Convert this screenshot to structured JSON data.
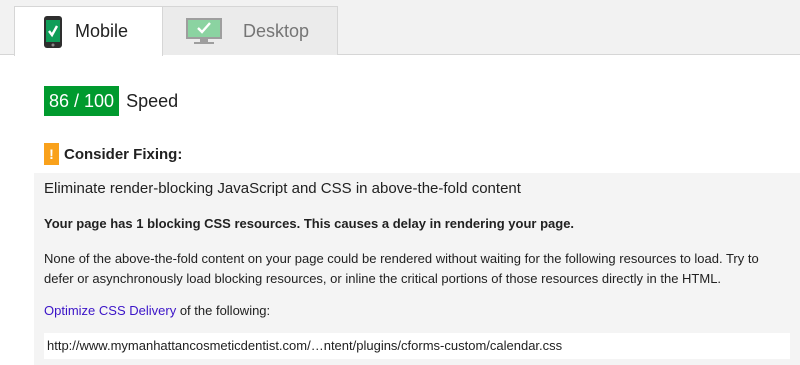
{
  "tabs": [
    {
      "label": "Mobile",
      "icon": "mobile-phone-icon",
      "active": true
    },
    {
      "label": "Desktop",
      "icon": "desktop-monitor-icon",
      "active": false
    }
  ],
  "score": {
    "value": "86 / 100",
    "label": "Speed",
    "color": "#009a2e"
  },
  "consider": {
    "icon": "warning-icon",
    "icon_glyph": "!",
    "label": "Consider Fixing:",
    "color": "#f9a11b"
  },
  "rule": {
    "title": "Eliminate render-blocking JavaScript and CSS in above-the-fold content",
    "summary": "Your page has 1 blocking CSS resources. This causes a delay in rendering your page.",
    "description": "None of the above-the-fold content on your page could be rendered without waiting for the following resources to load. Try to defer or asynchronously load blocking resources, or inline the critical portions of those resources directly in the HTML.",
    "link_text": "Optimize CSS Delivery",
    "link_suffix": " of the following:",
    "resources": [
      "http://www.mymanhattancosmeticdentist.com/…ntent/plugins/cforms-custom/calendar.css"
    ]
  }
}
